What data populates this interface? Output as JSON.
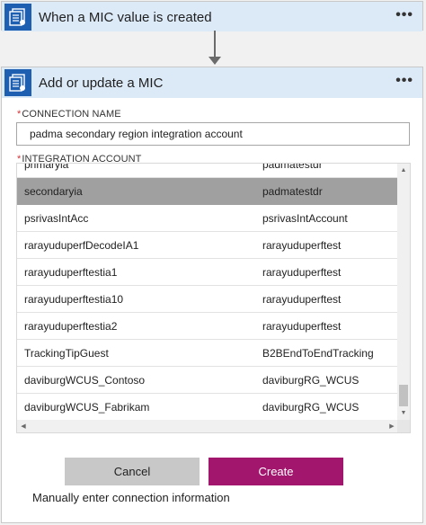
{
  "trigger": {
    "title": "When a MIC value is created",
    "more_label": "•••",
    "icon": "document-list-icon"
  },
  "action": {
    "title": "Add or update a MIC",
    "more_label": "•••",
    "icon": "document-list-icon"
  },
  "connection": {
    "required_mark": "*",
    "label": "CONNECTION NAME",
    "value": "padma secondary region integration account"
  },
  "integration_account": {
    "required_mark": "*",
    "label": "INTEGRATION ACCOUNT",
    "rows": [
      {
        "name": "primaryia",
        "group": "padmatestdr",
        "selected": false
      },
      {
        "name": "secondaryia",
        "group": "padmatestdr",
        "selected": true
      },
      {
        "name": "psrivasIntAcc",
        "group": "psrivasIntAccount",
        "selected": false
      },
      {
        "name": "rarayuduperfDecodeIA1",
        "group": "rarayuduperftest",
        "selected": false
      },
      {
        "name": "rarayuduperftestia1",
        "group": "rarayuduperftest",
        "selected": false
      },
      {
        "name": "rarayuduperftestia10",
        "group": "rarayuduperftest",
        "selected": false
      },
      {
        "name": "rarayuduperftestia2",
        "group": "rarayuduperftest",
        "selected": false
      },
      {
        "name": "TrackingTipGuest",
        "group": "B2BEndToEndTracking",
        "selected": false
      },
      {
        "name": "daviburgWCUS_Contoso",
        "group": "daviburgRG_WCUS",
        "selected": false
      },
      {
        "name": "daviburgWCUS_Fabrikam",
        "group": "daviburgRG_WCUS",
        "selected": false
      }
    ]
  },
  "buttons": {
    "cancel_label": "Cancel",
    "create_label": "Create"
  },
  "manual_link_label": "Manually enter connection information",
  "colors": {
    "header_bg": "#dceaf8",
    "icon_bg": "#1f5fb2",
    "create_bg": "#a2166e",
    "selected_row_bg": "#a0a0a0",
    "required": "#d13438"
  }
}
